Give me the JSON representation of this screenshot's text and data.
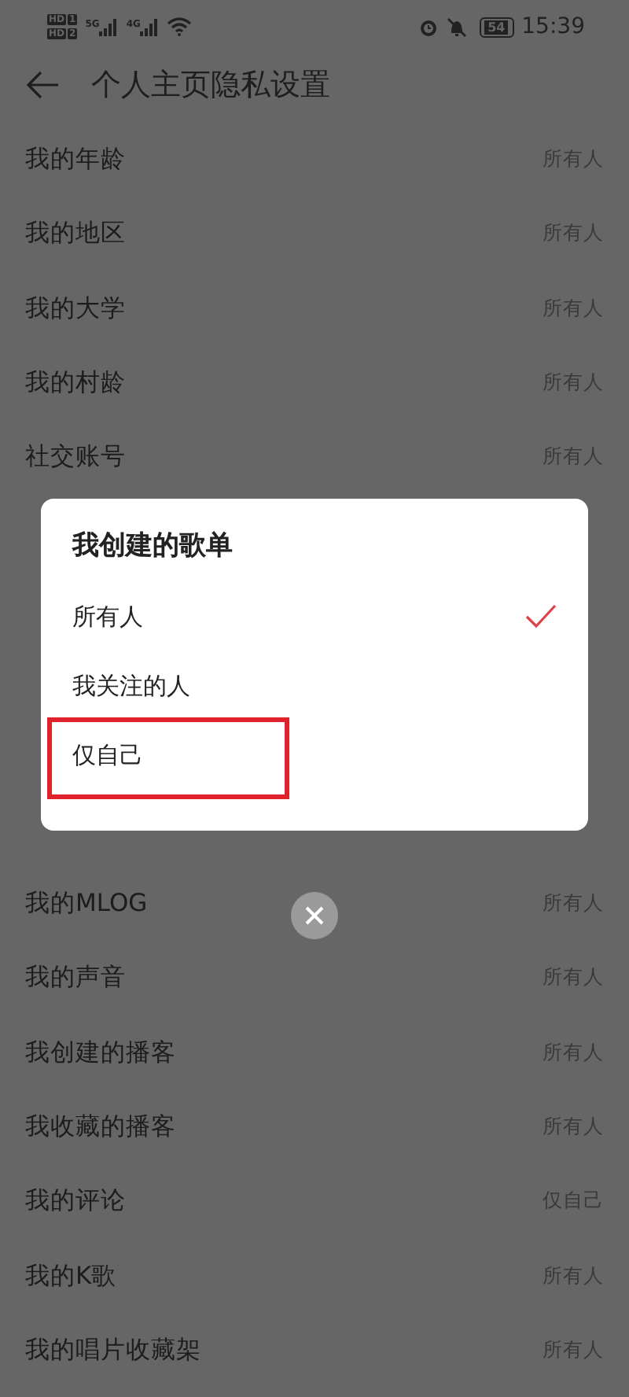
{
  "status_bar": {
    "sims": [
      {
        "badge": "HD",
        "slot": "1"
      },
      {
        "badge": "HD",
        "slot": "2"
      }
    ],
    "networks": [
      "5G",
      "4G"
    ],
    "battery": "54",
    "time": "15:39"
  },
  "header": {
    "title": "个人主页隐私设置"
  },
  "rows_above": [
    {
      "label": "我的年龄",
      "value": "所有人"
    },
    {
      "label": "我的地区",
      "value": "所有人"
    },
    {
      "label": "我的大学",
      "value": "所有人"
    },
    {
      "label": "我的村龄",
      "value": "所有人"
    },
    {
      "label": "社交账号",
      "value": "所有人"
    }
  ],
  "rows_below": [
    {
      "label": "我的MLOG",
      "value": "所有人"
    },
    {
      "label": "我的声音",
      "value": "所有人"
    },
    {
      "label": "我创建的播客",
      "value": "所有人"
    },
    {
      "label": "我收藏的播客",
      "value": "所有人"
    },
    {
      "label": "我的评论",
      "value": "仅自己"
    },
    {
      "label": "我的K歌",
      "value": "所有人"
    },
    {
      "label": "我的唱片收藏架",
      "value": "所有人"
    }
  ],
  "dialog": {
    "title": "我创建的歌单",
    "options": [
      {
        "label": "所有人",
        "selected": true,
        "highlighted": false
      },
      {
        "label": "我关注的人",
        "selected": false,
        "highlighted": false
      },
      {
        "label": "仅自己",
        "selected": false,
        "highlighted": true
      }
    ]
  }
}
